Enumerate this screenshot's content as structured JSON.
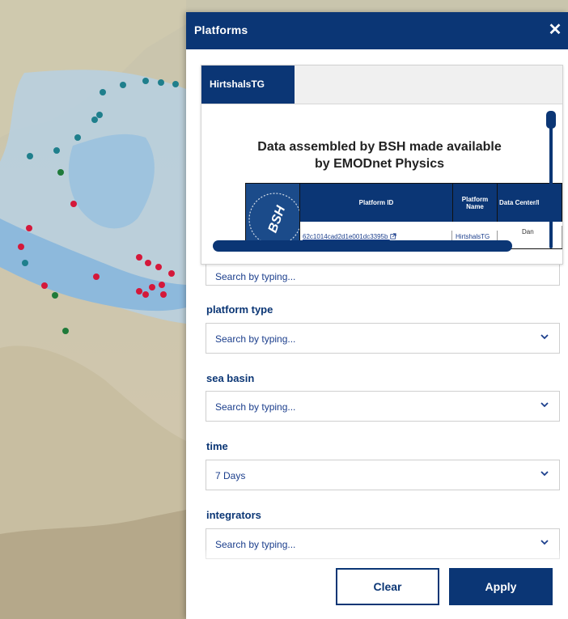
{
  "panel": {
    "title": "Platforms",
    "close_glyph": "✕"
  },
  "popup": {
    "tab_label": "HirtshalsTG",
    "heading": "Data assembled by BSH made available by EMODnet Physics",
    "table": {
      "logo_text": "BSH",
      "headers": [
        "Platform ID",
        "Platform Name",
        "Data Center/I"
      ],
      "row": [
        "62c1014cad2d1e001dc3395b",
        "HirtshalsTG",
        "Dan"
      ]
    }
  },
  "filters": {
    "first_value": "Search by typing...",
    "items": [
      {
        "label": "platform type",
        "value": "Search by typing..."
      },
      {
        "label": "sea basin",
        "value": "Search by typing..."
      },
      {
        "label": "time",
        "value": "7 Days"
      },
      {
        "label": "integrators",
        "value": "Search by typing..."
      }
    ]
  },
  "buttons": {
    "clear": "Clear",
    "apply": "Apply"
  },
  "icons": {
    "close": "close-icon",
    "chevron": "chevron-down-icon",
    "external": "external-link-icon"
  },
  "colors": {
    "brand": "#0b3675",
    "link": "#1b3e8c",
    "dot_red": "#d4183a",
    "dot_teal": "#1f7f8c",
    "dot_green": "#1f7a3a"
  }
}
